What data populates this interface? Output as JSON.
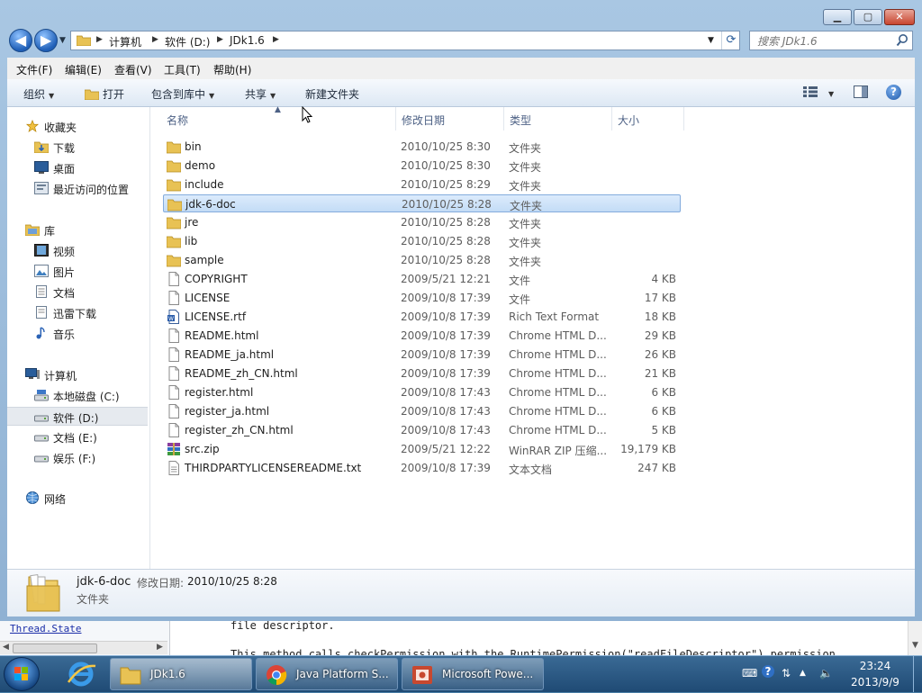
{
  "background_window": {
    "link": "Thread.State",
    "line1": "file descriptor.",
    "line2": "This method calls checkPermission with the RuntimePermission(\"readFileDescriptor\") permission."
  },
  "window": {
    "nav": {
      "back": "◀",
      "forward": "▶"
    },
    "breadcrumb": [
      "计算机",
      "软件 (D:)",
      "JDk1.6"
    ],
    "search_placeholder": "搜索 JDk1.6",
    "menu": [
      "文件(F)",
      "编辑(E)",
      "查看(V)",
      "工具(T)",
      "帮助(H)"
    ],
    "toolbar": {
      "organize": "组织",
      "open": "打开",
      "include_library": "包含到库中",
      "share": "共享",
      "new_folder": "新建文件夹",
      "help": "?"
    }
  },
  "sidebar": {
    "favorites": {
      "label": "收藏夹",
      "items": [
        "下载",
        "桌面",
        "最近访问的位置"
      ]
    },
    "libraries": {
      "label": "库",
      "items": [
        "视频",
        "图片",
        "文档",
        "迅雷下载",
        "音乐"
      ]
    },
    "computer": {
      "label": "计算机",
      "items": [
        "本地磁盘 (C:)",
        "软件 (D:)",
        "文档 (E:)",
        "娱乐 (F:)"
      ],
      "selected_index": 1
    },
    "network": {
      "label": "网络"
    }
  },
  "columns": {
    "name": "名称",
    "date": "修改日期",
    "type": "类型",
    "size": "大小"
  },
  "files": [
    {
      "name": "bin",
      "date": "2010/10/25 8:30",
      "type": "文件夹",
      "size": "",
      "icon": "folder"
    },
    {
      "name": "demo",
      "date": "2010/10/25 8:30",
      "type": "文件夹",
      "size": "",
      "icon": "folder"
    },
    {
      "name": "include",
      "date": "2010/10/25 8:29",
      "type": "文件夹",
      "size": "",
      "icon": "folder"
    },
    {
      "name": "jdk-6-doc",
      "date": "2010/10/25 8:28",
      "type": "文件夹",
      "size": "",
      "icon": "folder",
      "selected": true
    },
    {
      "name": "jre",
      "date": "2010/10/25 8:28",
      "type": "文件夹",
      "size": "",
      "icon": "folder"
    },
    {
      "name": "lib",
      "date": "2010/10/25 8:28",
      "type": "文件夹",
      "size": "",
      "icon": "folder"
    },
    {
      "name": "sample",
      "date": "2010/10/25 8:28",
      "type": "文件夹",
      "size": "",
      "icon": "folder"
    },
    {
      "name": "COPYRIGHT",
      "date": "2009/5/21 12:21",
      "type": "文件",
      "size": "4 KB",
      "icon": "file"
    },
    {
      "name": "LICENSE",
      "date": "2009/10/8 17:39",
      "type": "文件",
      "size": "17 KB",
      "icon": "file"
    },
    {
      "name": "LICENSE.rtf",
      "date": "2009/10/8 17:39",
      "type": "Rich Text Format",
      "size": "18 KB",
      "icon": "rtf"
    },
    {
      "name": "README.html",
      "date": "2009/10/8 17:39",
      "type": "Chrome HTML D...",
      "size": "29 KB",
      "icon": "file"
    },
    {
      "name": "README_ja.html",
      "date": "2009/10/8 17:39",
      "type": "Chrome HTML D...",
      "size": "26 KB",
      "icon": "file"
    },
    {
      "name": "README_zh_CN.html",
      "date": "2009/10/8 17:39",
      "type": "Chrome HTML D...",
      "size": "21 KB",
      "icon": "file"
    },
    {
      "name": "register.html",
      "date": "2009/10/8 17:43",
      "type": "Chrome HTML D...",
      "size": "6 KB",
      "icon": "file"
    },
    {
      "name": "register_ja.html",
      "date": "2009/10/8 17:43",
      "type": "Chrome HTML D...",
      "size": "6 KB",
      "icon": "file"
    },
    {
      "name": "register_zh_CN.html",
      "date": "2009/10/8 17:43",
      "type": "Chrome HTML D...",
      "size": "5 KB",
      "icon": "file"
    },
    {
      "name": "src.zip",
      "date": "2009/5/21 12:22",
      "type": "WinRAR ZIP 压缩...",
      "size": "19,179 KB",
      "icon": "zip"
    },
    {
      "name": "THIRDPARTYLICENSEREADME.txt",
      "date": "2009/10/8 17:39",
      "type": "文本文档",
      "size": "247 KB",
      "icon": "txt"
    }
  ],
  "details": {
    "name": "jdk-6-doc",
    "date_label": "修改日期:",
    "date_value": "2010/10/25 8:28",
    "type": "文件夹"
  },
  "taskbar": {
    "tasks": [
      {
        "label": "JDk1.6",
        "icon": "folder-icon",
        "active": true
      },
      {
        "label": "Java Platform S...",
        "icon": "chrome-icon"
      },
      {
        "label": "Microsoft Powe...",
        "icon": "powerpoint-icon"
      }
    ],
    "time": "23:24",
    "date": "2013/9/9"
  },
  "colors": {
    "folder": "#e8c254",
    "selection": "#cce4fb",
    "accent": "#1f5fb7"
  }
}
